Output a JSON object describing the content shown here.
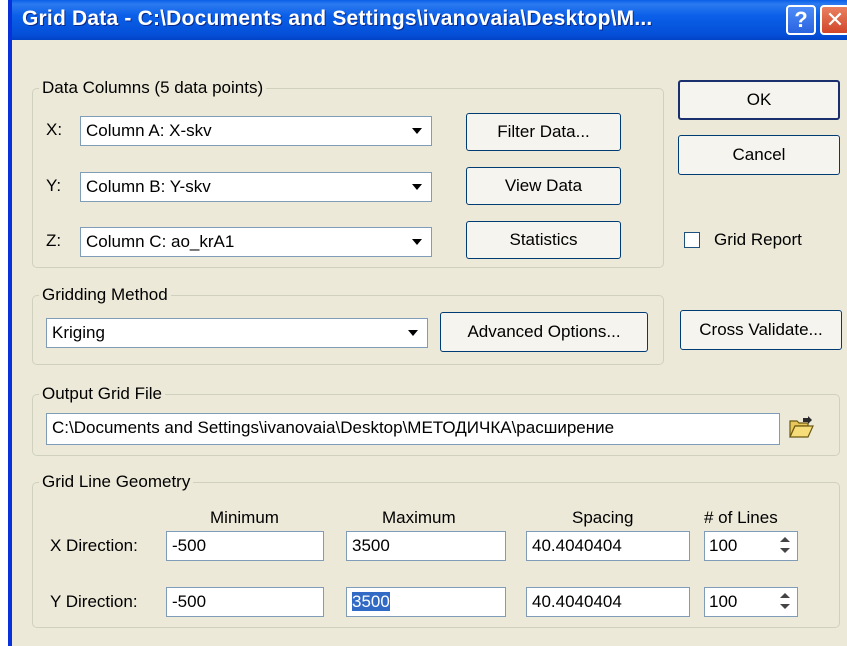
{
  "window": {
    "title": "Grid Data - C:\\Documents and Settings\\ivanovaia\\Desktop\\M..."
  },
  "data_columns": {
    "legend": "Data Columns   (5 data points)",
    "x_label": "X:",
    "x_value": "Column A:  X-skv",
    "y_label": "Y:",
    "y_value": "Column B:  Y-skv",
    "z_label": "Z:",
    "z_value": "Column C:  ao_krA1",
    "filter_button": "Filter Data...",
    "view_button": "View Data",
    "statistics_button": "Statistics"
  },
  "side": {
    "ok": "OK",
    "cancel": "Cancel",
    "grid_report": "Grid Report",
    "grid_report_checked": false,
    "cross_validate": "Cross Validate..."
  },
  "gridding": {
    "legend": "Gridding Method",
    "method": "Kriging",
    "advanced_button": "Advanced Options..."
  },
  "output": {
    "legend": "Output Grid File",
    "path": "C:\\Documents and Settings\\ivanovaia\\Desktop\\МЕТОДИЧКА\\расширение"
  },
  "geometry": {
    "legend": "Grid Line Geometry",
    "headers": {
      "minimum": "Minimum",
      "maximum": "Maximum",
      "spacing": "Spacing",
      "lines": "# of Lines"
    },
    "x": {
      "label": "X Direction:",
      "min": "-500",
      "max": "3500",
      "spacing": "40.4040404",
      "lines": "100"
    },
    "y": {
      "label": "Y Direction:",
      "min": "-500",
      "max": "3500",
      "spacing": "40.4040404",
      "lines": "100"
    }
  }
}
